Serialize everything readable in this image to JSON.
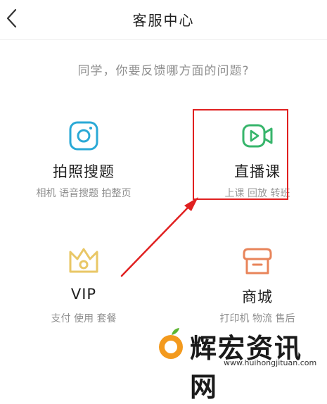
{
  "header": {
    "title": "客服中心",
    "back_icon": "chevron-left-icon"
  },
  "question": "同学，你要反馈哪方面的问题?",
  "cards": [
    {
      "name": "拍照搜题",
      "sub": "相机 语音搜题 拍整页",
      "icon": "camera-icon",
      "color": "#2aa9d6"
    },
    {
      "name": "直播课",
      "sub": "上课 回放 转班",
      "icon": "video-play-icon",
      "color": "#37b56b"
    },
    {
      "name": "VIP",
      "sub": "支付 使用 套餐",
      "icon": "crown-icon",
      "color": "#e9c766"
    },
    {
      "name": "商城",
      "sub": "打印机 物流 售后",
      "icon": "shop-icon",
      "color": "#e8845a"
    }
  ],
  "annotation": {
    "color": "#e02020"
  },
  "watermark": {
    "text": "辉宏资讯网",
    "url": "www.huihongjituan.com"
  }
}
